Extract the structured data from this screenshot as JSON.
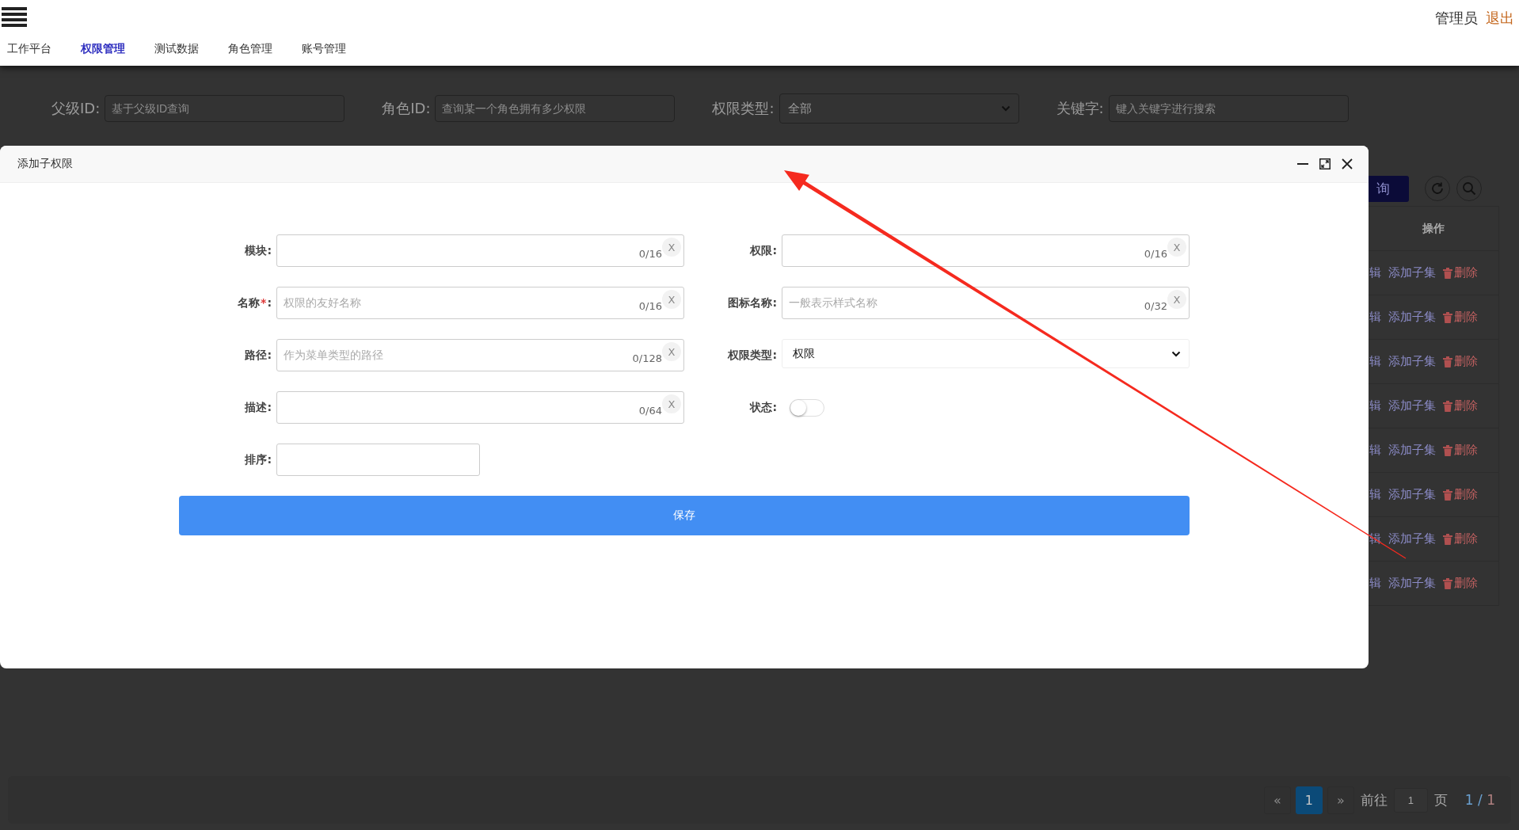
{
  "header": {
    "nav": [
      {
        "label": "工作平台",
        "selected": false
      },
      {
        "label": "权限管理",
        "selected": true
      },
      {
        "label": "测试数据",
        "selected": false
      },
      {
        "label": "角色管理",
        "selected": false
      },
      {
        "label": "账号管理",
        "selected": false
      }
    ],
    "user": "管理员",
    "logout": "退出"
  },
  "filters": [
    {
      "label": "父级ID:",
      "kind": "input",
      "placeholder": "基于父级ID查询"
    },
    {
      "label": "角色ID:",
      "kind": "input",
      "placeholder": "查询某一个角色拥有多少权限"
    },
    {
      "label": "权限类型:",
      "kind": "select",
      "value": "全部"
    },
    {
      "label": "关键字:",
      "kind": "input",
      "placeholder": "键入关键字进行搜索"
    }
  ],
  "toolbar": {
    "query_button": "询"
  },
  "table": {
    "columns": [
      "操作"
    ],
    "rows": [
      {
        "edit": "辑",
        "add_child": "添加子集",
        "delete": "删除"
      },
      {
        "edit": "辑",
        "add_child": "添加子集",
        "delete": "删除"
      },
      {
        "edit": "辑",
        "add_child": "添加子集",
        "delete": "删除"
      },
      {
        "edit": "辑",
        "add_child": "添加子集",
        "delete": "删除"
      },
      {
        "edit": "辑",
        "add_child": "添加子集",
        "delete": "删除"
      },
      {
        "edit": "辑",
        "add_child": "添加子集",
        "delete": "删除"
      },
      {
        "edit": "辑",
        "add_child": "添加子集",
        "delete": "删除"
      },
      {
        "edit": "辑",
        "add_child": "添加子集",
        "delete": "删除"
      }
    ]
  },
  "pagination": {
    "prev": "«",
    "pages": [
      {
        "label": "1",
        "selected": true
      }
    ],
    "next": "»",
    "goto_label": "前往",
    "goto_value": "1",
    "page_unit": "页",
    "current": "1",
    "separator": "/",
    "total": "1"
  },
  "modal": {
    "title": "添加子权限",
    "fields": [
      {
        "label": "模块:",
        "kind": "input",
        "required": false,
        "counter": "0/16",
        "clear": "X"
      },
      {
        "label": "权限:",
        "kind": "input",
        "required": false,
        "counter": "0/16",
        "clear": "X"
      },
      {
        "label": "名称",
        "kind": "input",
        "required": true,
        "marker": "*",
        "colon": ":",
        "placeholder": "权限的友好名称",
        "counter": "0/16",
        "clear": "X"
      },
      {
        "label": "图标名称:",
        "kind": "input",
        "required": false,
        "placeholder": "一般表示样式名称",
        "counter": "0/32",
        "clear": "X"
      },
      {
        "label": "路径:",
        "kind": "input",
        "required": false,
        "placeholder": "作为菜单类型的路径",
        "counter": "0/128",
        "clear": "X"
      },
      {
        "label": "权限类型:",
        "kind": "select",
        "required": false,
        "value": "权限"
      },
      {
        "label": "描述:",
        "kind": "input",
        "required": false,
        "counter": "0/64",
        "clear": "X"
      },
      {
        "label": "状态:",
        "kind": "switch",
        "required": false,
        "on": false
      },
      {
        "label": "排序:",
        "kind": "short_input",
        "required": false
      }
    ],
    "save_button": "保存"
  },
  "annotation": {
    "kind": "arrow"
  }
}
